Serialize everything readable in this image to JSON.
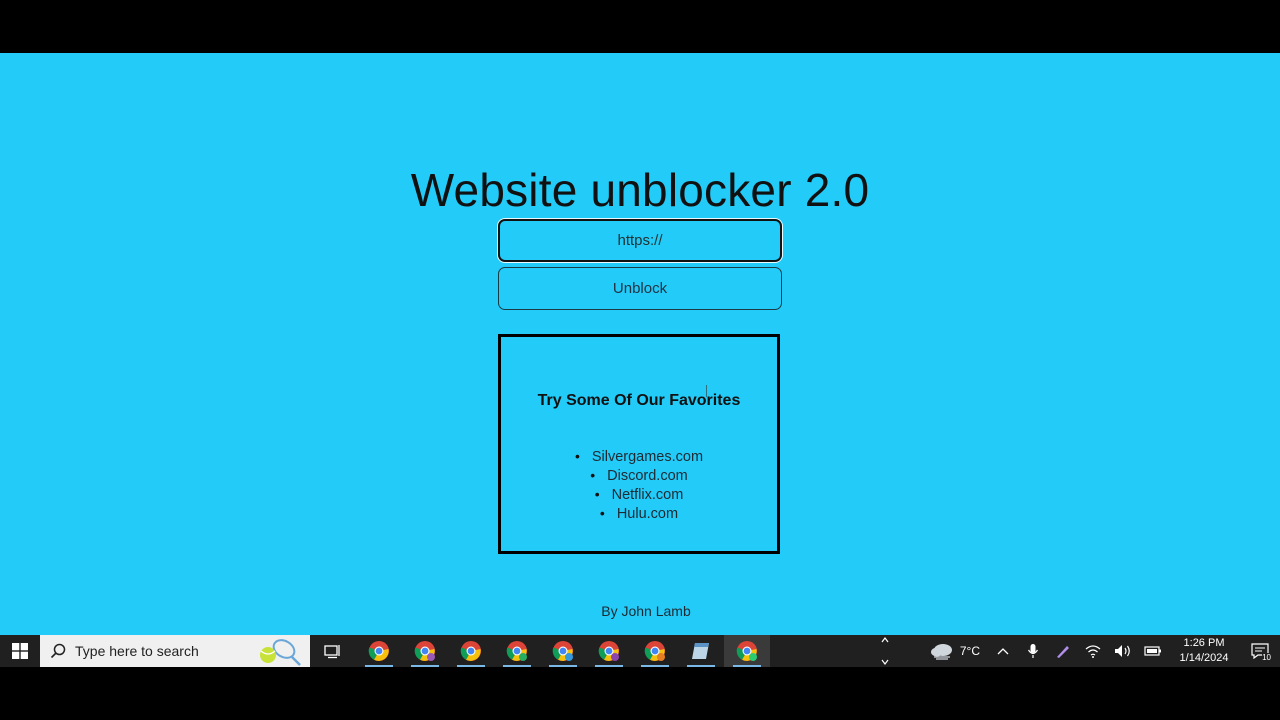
{
  "page": {
    "title": "Website unblocker 2.0",
    "url_input": {
      "placeholder": "https://",
      "value": ""
    },
    "unblock_button": "Unblock",
    "favorites": {
      "heading": "Try Some Of Our Favorites",
      "items": [
        "Silvergames.com",
        "Discord.com",
        "Netflix.com",
        "Hulu.com"
      ]
    },
    "byline": "By John Lamb"
  },
  "taskbar": {
    "search_placeholder": "Type here to search",
    "apps": [
      "chrome-icon",
      "chrome-icon",
      "chrome-icon",
      "chrome-icon",
      "chrome-icon",
      "chrome-icon",
      "chrome-icon",
      "notepad-icon",
      "chrome-icon"
    ],
    "weather": {
      "temp": "7°C",
      "icon": "cloud-icon"
    },
    "clock": {
      "time": "1:26 PM",
      "date": "1/14/2024"
    },
    "notification_count": "10"
  },
  "colors": {
    "page_bg": "#22cbf8",
    "taskbar_bg": "#202020",
    "text": "#111111"
  }
}
